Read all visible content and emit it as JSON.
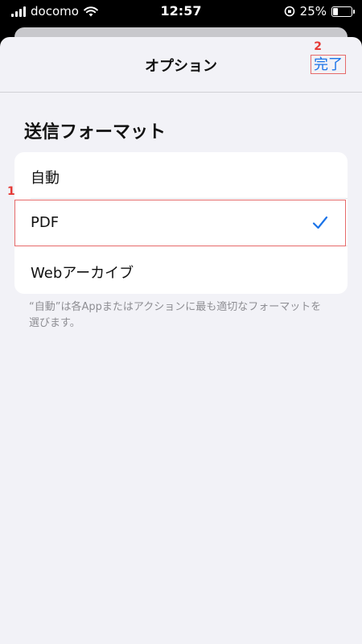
{
  "status_bar": {
    "carrier": "docomo",
    "time": "12:57",
    "battery_percent": "25%",
    "battery_level": 0.25
  },
  "nav": {
    "title": "オプション",
    "done_label": "完了"
  },
  "annotations": {
    "badge_1": "1",
    "badge_2": "2"
  },
  "section": {
    "title": "送信フォーマット",
    "options": [
      {
        "label": "自動",
        "selected": false
      },
      {
        "label": "PDF",
        "selected": true
      },
      {
        "label": "Webアーカイブ",
        "selected": false
      }
    ],
    "footer": "“自動”は各Appまたはアクションに最も適切なフォーマットを選びます。"
  },
  "colors": {
    "accent": "#1a73e8",
    "annotation": "#e53935"
  }
}
